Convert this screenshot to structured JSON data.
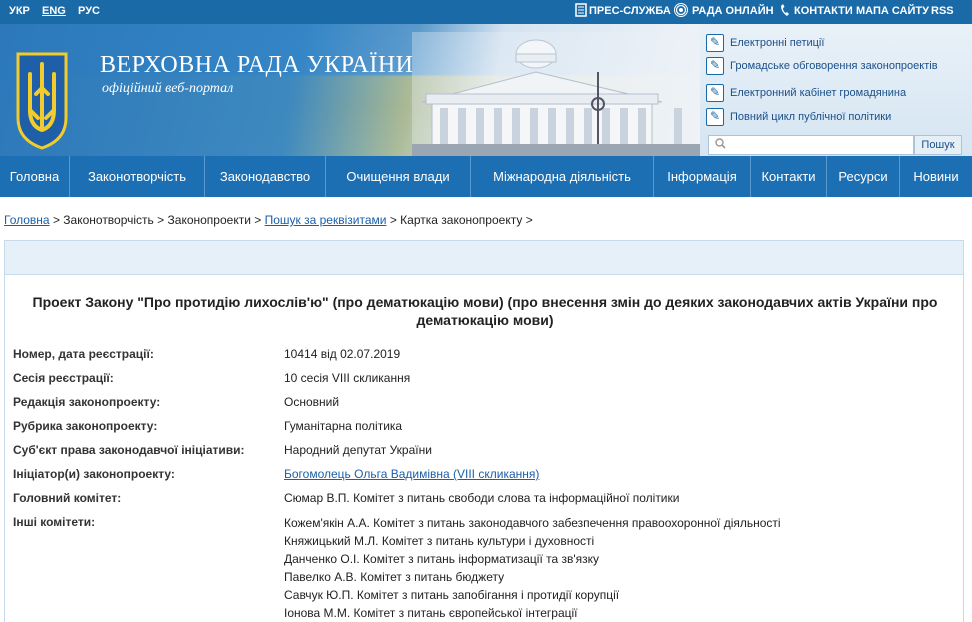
{
  "topbar": {
    "langs": [
      "УКР",
      "ENG",
      "РУС"
    ],
    "links": [
      "ПРЕС-СЛУЖБА",
      "РАДА ОНЛАЙН",
      "КОНТАКТИ",
      "МАПА САЙТУ",
      "RSS"
    ]
  },
  "header": {
    "title": "ВЕРХОВНА РАДА УКРАЇНИ",
    "subtitle": "офіційний веб-портал",
    "side_links": [
      "Електронні петиції",
      "Громадське обговорення законопроектів",
      "Електронний кабінет громадянина",
      "Повний цикл публічної політики"
    ],
    "search": {
      "placeholder": "",
      "button": "Пошук"
    }
  },
  "nav": [
    "Головна",
    "Законотворчість",
    "Законодавство",
    "Очищення влади",
    "Міжнародна діяльність",
    "Інформація",
    "Контакти",
    "Ресурси",
    "Новини"
  ],
  "breadcrumb": {
    "items": [
      {
        "label": "Головна",
        "link": true
      },
      {
        "label": "Законотворчість",
        "link": false
      },
      {
        "label": "Законопроекти",
        "link": false
      },
      {
        "label": "Пошук за реквізитами",
        "link": true
      },
      {
        "label": "Картка законопроекту",
        "link": false
      }
    ],
    "separator": ">"
  },
  "bill": {
    "title_line1": "Проект Закону \"Про протидію лихослів'ю\" (про дематюкацію мови) (про внесення змін до деяких законодавчих актів України про",
    "title_line2": "дематюкацію мови)",
    "rows": [
      {
        "label": "Номер, дата реєстрації:",
        "value": "10414 від 02.07.2019"
      },
      {
        "label": "Сесія реєстрації:",
        "value": "10 сесія VIII скликання"
      },
      {
        "label": "Редакція законопроекту:",
        "value": "Основний"
      },
      {
        "label": "Рубрика законопроекту:",
        "value": "Гуманітарна політика"
      },
      {
        "label": "Суб'єкт права законодавчої ініціативи:",
        "value": "Народний депутат України"
      },
      {
        "label": "Ініціатор(и) законопроекту:",
        "value": "Богомолець Ольга Вадимівна (VIII скликання)"
      },
      {
        "label": "Головний комітет:",
        "value": "Сюмар В.П. Комітет з питань свободи слова та інформаційної політики"
      }
    ],
    "other_label": "Інші комітети:",
    "other_committees": [
      "Кожем'якін А.А. Комітет з питань законодавчого забезпечення правоохоронної діяльності",
      "Княжицький М.Л. Комітет з питань культури і духовності",
      "Данченко О.І. Комітет з питань інформатизації та зв'язку",
      "Павелко А.В. Комітет з питань бюджету",
      "Савчук Ю.П. Комітет з питань запобігання і протидії корупції",
      "Іонова М.М. Комітет з питань європейської інтеграції"
    ]
  },
  "colors": {
    "topbar": "#1b6aa8",
    "nav": "#1d6fb3",
    "link": "#1b5fa8",
    "flag_yellow": "#f2cb2c"
  }
}
